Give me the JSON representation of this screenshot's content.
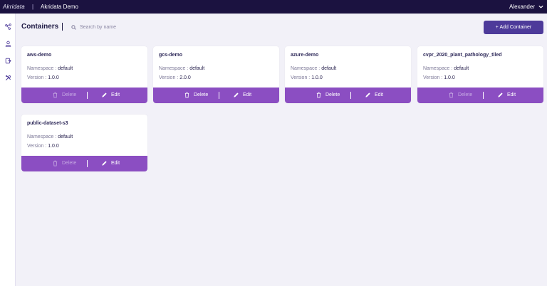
{
  "topbar": {
    "logo": "Akridata",
    "separator": "|",
    "app_name": "Akridata Demo",
    "user_name": "Alexander",
    "background": "#1b1240"
  },
  "sidebar": {
    "icons": [
      "share-nodes-icon",
      "user-icon",
      "document-export-icon",
      "tools-icon"
    ]
  },
  "header": {
    "title": "Containers",
    "search_placeholder": "Search by name",
    "add_button_label": "+ Add Container"
  },
  "labels": {
    "namespace": "Namespace :",
    "version": "Version :",
    "delete": "Delete",
    "edit": "Edit"
  },
  "containers": [
    {
      "name": "aws-demo",
      "namespace": "default",
      "version": "1.0.0",
      "delete_enabled": false
    },
    {
      "name": "gcs-demo",
      "namespace": "default",
      "version": "2.0.0",
      "delete_enabled": true
    },
    {
      "name": "azure-demo",
      "namespace": "default",
      "version": "1.0.0",
      "delete_enabled": true
    },
    {
      "name": "cvpr_2020_plant_pathology_tiled",
      "namespace": "default",
      "version": "1.0.0",
      "delete_enabled": false
    },
    {
      "name": "public-dataset-s3",
      "namespace": "default",
      "version": "1.0.0",
      "delete_enabled": false
    }
  ],
  "colors": {
    "accent": "#8b4ec2",
    "primary_button": "#4d3a9a",
    "page_background": "#f2f1f8"
  }
}
